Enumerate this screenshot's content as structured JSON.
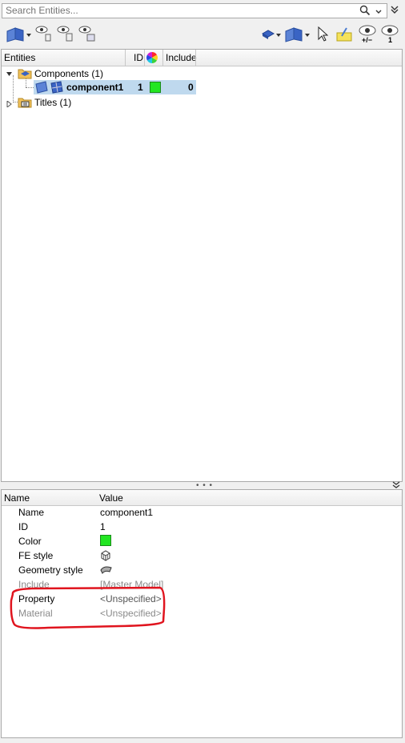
{
  "search": {
    "placeholder": "Search Entities..."
  },
  "tree": {
    "headers": {
      "entities": "Entities",
      "id": "ID",
      "include": "Include"
    },
    "components_label": "Components (1)",
    "component": {
      "name": "component1",
      "id": "1",
      "include": "0",
      "color": "#22e622"
    },
    "titles_label": "Titles (1)"
  },
  "toolbar": {
    "eye_plus_minus_label": "+/−",
    "eye_one_label": "1"
  },
  "splitter": {
    "dots": "• • •"
  },
  "properties": {
    "headers": {
      "name": "Name",
      "value": "Value"
    },
    "rows": [
      {
        "name": "Name",
        "value": "component1"
      },
      {
        "name": "ID",
        "value": "1"
      },
      {
        "name": "Color",
        "value": ""
      },
      {
        "name": "FE style",
        "value": ""
      },
      {
        "name": "Geometry style",
        "value": ""
      },
      {
        "name": "Include",
        "value": "[Master Model]"
      },
      {
        "name": "Property",
        "value": "<Unspecified>"
      },
      {
        "name": "Material",
        "value": "<Unspecified>"
      }
    ]
  },
  "colors": {
    "selection": "#bfd9ee",
    "highlight_annotation": "#e0141e",
    "component_color": "#22e622"
  }
}
